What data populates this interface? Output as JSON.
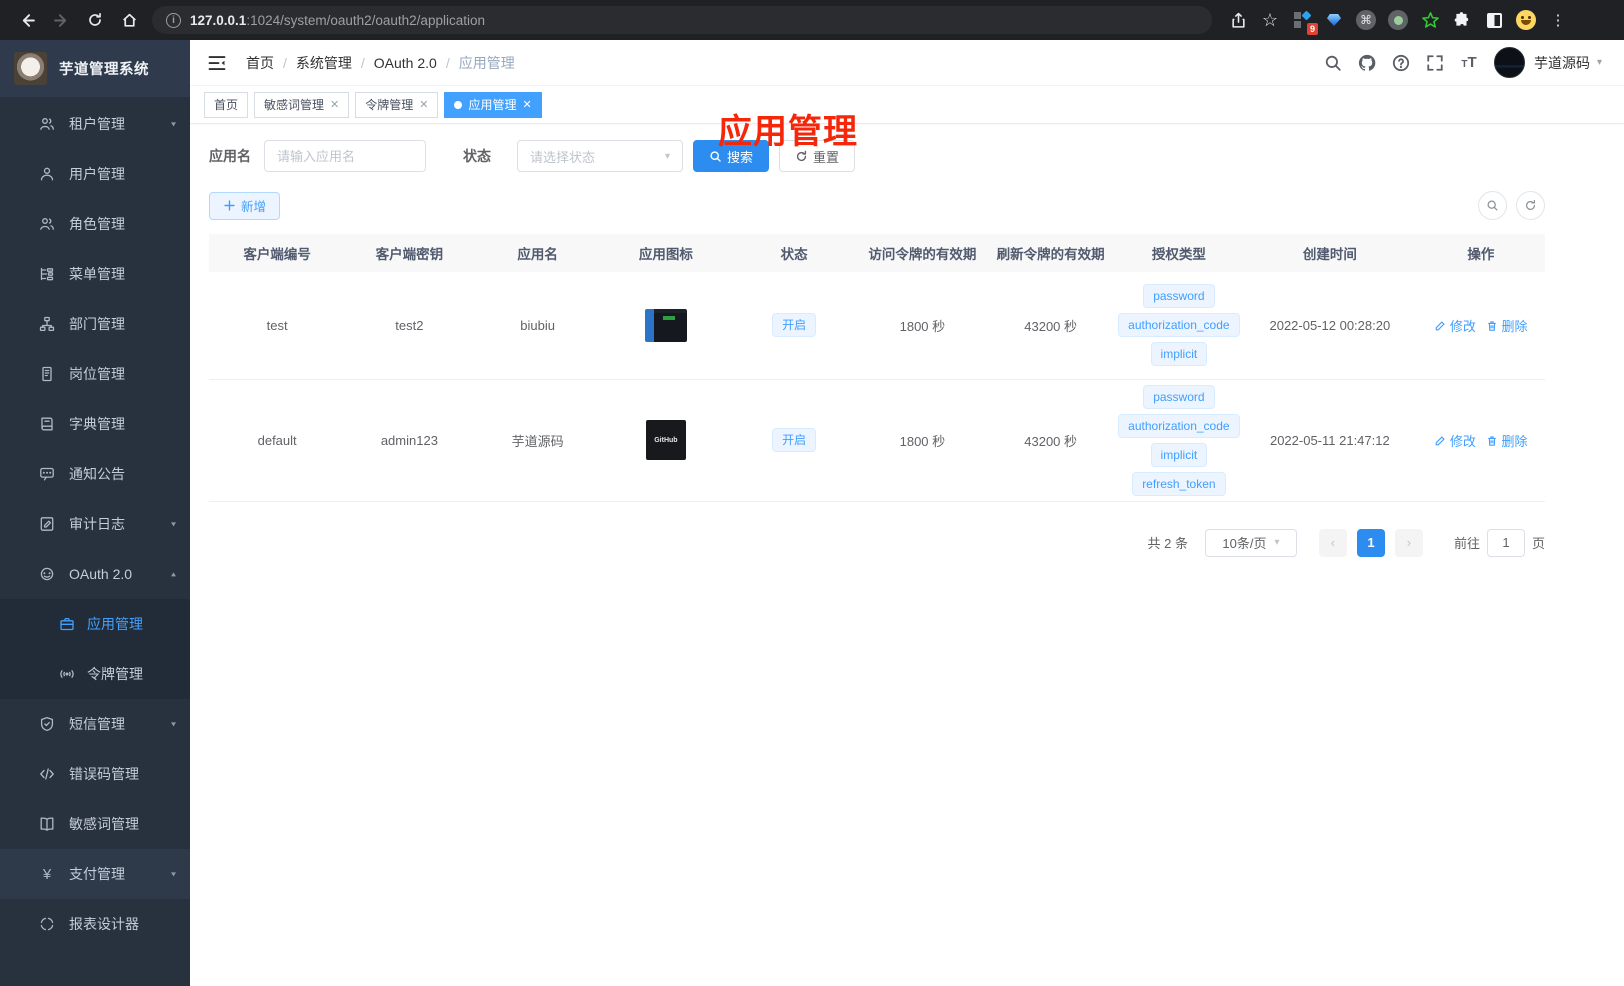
{
  "browser": {
    "url_host": "127.0.0.1",
    "url_rest": ":1024/system/oauth2/oauth2/application",
    "extension_badge": "9"
  },
  "sidebar": {
    "title": "芋道管理系统",
    "items": [
      {
        "label": "租户管理",
        "icon": "tenant-users-icon",
        "arrow": "down"
      },
      {
        "label": "用户管理",
        "icon": "user-icon"
      },
      {
        "label": "角色管理",
        "icon": "role-users-icon"
      },
      {
        "label": "菜单管理",
        "icon": "menu-tree-icon"
      },
      {
        "label": "部门管理",
        "icon": "org-tree-icon"
      },
      {
        "label": "岗位管理",
        "icon": "id-badge-icon"
      },
      {
        "label": "字典管理",
        "icon": "dictionary-icon"
      },
      {
        "label": "通知公告",
        "icon": "message-icon"
      },
      {
        "label": "审计日志",
        "icon": "audit-log-icon",
        "arrow": "down"
      },
      {
        "label": "OAuth 2.0",
        "icon": "robot-icon",
        "arrow": "up",
        "children": [
          {
            "label": "应用管理",
            "icon": "briefcase-icon",
            "active": true
          },
          {
            "label": "令牌管理",
            "icon": "signal-icon"
          }
        ]
      },
      {
        "label": "短信管理",
        "icon": "shield-icon",
        "arrow": "down"
      },
      {
        "label": "错误码管理",
        "icon": "code-icon"
      },
      {
        "label": "敏感词管理",
        "icon": "open-book-icon"
      },
      {
        "label": "支付管理",
        "icon": "yen-icon",
        "arrow": "down"
      },
      {
        "label": "报表设计器",
        "icon": "report-icon"
      }
    ]
  },
  "navbar": {
    "breadcrumb": [
      "首页",
      "系统管理",
      "OAuth 2.0",
      "应用管理"
    ],
    "username": "芋道源码"
  },
  "tabs": [
    {
      "label": "首页"
    },
    {
      "label": "敏感词管理",
      "closable": true
    },
    {
      "label": "令牌管理",
      "closable": true
    },
    {
      "label": "应用管理",
      "closable": true,
      "active": true
    }
  ],
  "overlay": {
    "text": "应用管理",
    "color": "#f5270b"
  },
  "filters": {
    "name_label": "应用名",
    "name_placeholder": "请输入应用名",
    "status_label": "状态",
    "status_placeholder": "请选择状态",
    "search_label": "搜索",
    "reset_label": "重置",
    "add_label": "新增"
  },
  "table": {
    "headers": [
      "客户端编号",
      "客户端密钥",
      "应用名",
      "应用图标",
      "状态",
      "访问令牌的有效期",
      "刷新令牌的有效期",
      "授权类型",
      "创建时间",
      "操作"
    ],
    "rows": [
      {
        "client_id": "test",
        "secret": "test2",
        "name": "biubiu",
        "status": "开启",
        "access_ttl": "1800 秒",
        "refresh_ttl": "43200 秒",
        "grants": [
          "password",
          "authorization_code",
          "implicit"
        ],
        "created": "2022-05-12 00:28:20",
        "edit_label": "修改",
        "delete_label": "删除"
      },
      {
        "client_id": "default",
        "secret": "admin123",
        "name": "芋道源码",
        "status": "开启",
        "access_ttl": "1800 秒",
        "refresh_ttl": "43200 秒",
        "grants": [
          "password",
          "authorization_code",
          "implicit",
          "refresh_token"
        ],
        "created": "2022-05-11 21:47:12",
        "edit_label": "修改",
        "delete_label": "删除"
      }
    ]
  },
  "pagination": {
    "total": "共 2 条",
    "page_size": "10条/页",
    "current": "1",
    "goto_label": "前往",
    "goto_value": "1",
    "page_suffix": "页"
  },
  "colors": {
    "accent": "#409eff",
    "overlay_red": "#f5270b",
    "sidebar_bg": "#28313e"
  }
}
